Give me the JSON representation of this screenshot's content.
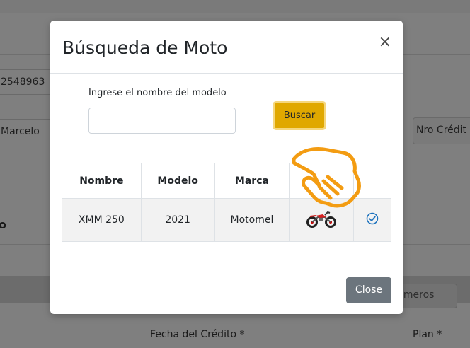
{
  "background": {
    "field_phone": "2548963",
    "field_name": "Marcelo",
    "field_credit_right": "Nro Crédit",
    "section_letter": "o",
    "field_numbers_right": "úmeros",
    "label_fecha": "Fecha del Crédito *",
    "label_plan": "Plan *"
  },
  "modal": {
    "title": "Búsqueda de Moto",
    "close_symbol": "×",
    "search_label": "Ingrese el nombre del modelo",
    "search_value": "",
    "search_button": "Buscar",
    "table": {
      "headers": [
        "Nombre",
        "Modelo",
        "Marca",
        "",
        ""
      ],
      "rows": [
        {
          "nombre": "XMM 250",
          "modelo": "2021",
          "marca": "Motomel"
        }
      ]
    },
    "close_button": "Close"
  },
  "colors": {
    "buscar": "#e0a800",
    "close": "#6c757d",
    "hand": "#f39c12",
    "check": "#1e73be"
  },
  "icons": [
    "close-icon",
    "motorcycle-icon",
    "check-circle-icon",
    "hand-pointer-icon"
  ]
}
